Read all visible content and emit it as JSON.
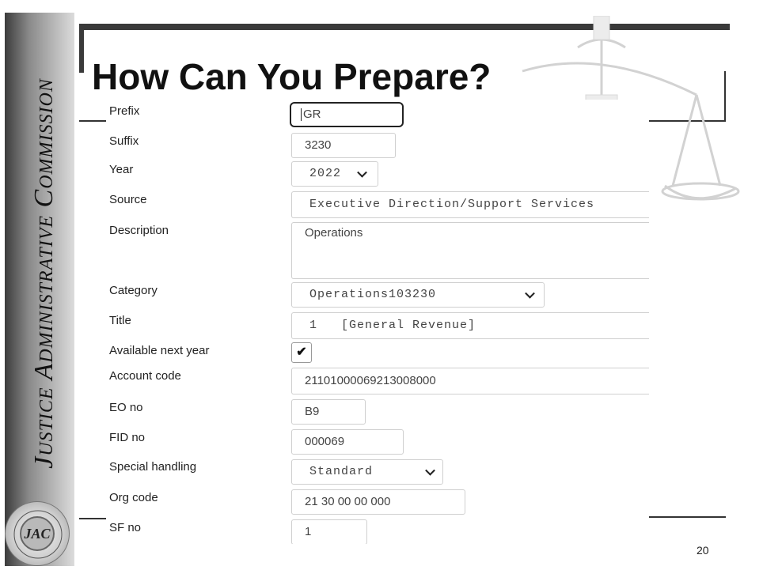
{
  "sidebar": {
    "text_parts": [
      "J",
      "ustice ",
      "A",
      "dministrative ",
      "C",
      "ommission"
    ],
    "seal_label": "JAC",
    "seal_ring_text": "Justice Administrative Commission"
  },
  "slide": {
    "title": "How Can You Prepare?",
    "page_number": "20"
  },
  "form": {
    "prefix": {
      "label": "Prefix",
      "value": "GR"
    },
    "suffix": {
      "label": "Suffix",
      "value": "3230"
    },
    "year": {
      "label": "Year",
      "value": "2022"
    },
    "source": {
      "label": "Source",
      "value": "Executive Direction/Support Services"
    },
    "description": {
      "label": "Description",
      "value": "Operations"
    },
    "category": {
      "label": "Category",
      "value": "Operations103230"
    },
    "title_field": {
      "label": "Title",
      "value": "1   [General Revenue]"
    },
    "available_next_year": {
      "label": "Available next year",
      "checked": true,
      "check_glyph": "✔"
    },
    "account_code": {
      "label": "Account code",
      "value": "21101000069213008000"
    },
    "eo_no": {
      "label": "EO no",
      "value": "B9"
    },
    "fid_no": {
      "label": "FID no",
      "value": "000069"
    },
    "special_handling": {
      "label": "Special handling",
      "value": "Standard"
    },
    "org_code": {
      "label": "Org code",
      "value": "21 30 00 00 000"
    },
    "sf_no": {
      "label": "SF no",
      "value": "1"
    }
  }
}
